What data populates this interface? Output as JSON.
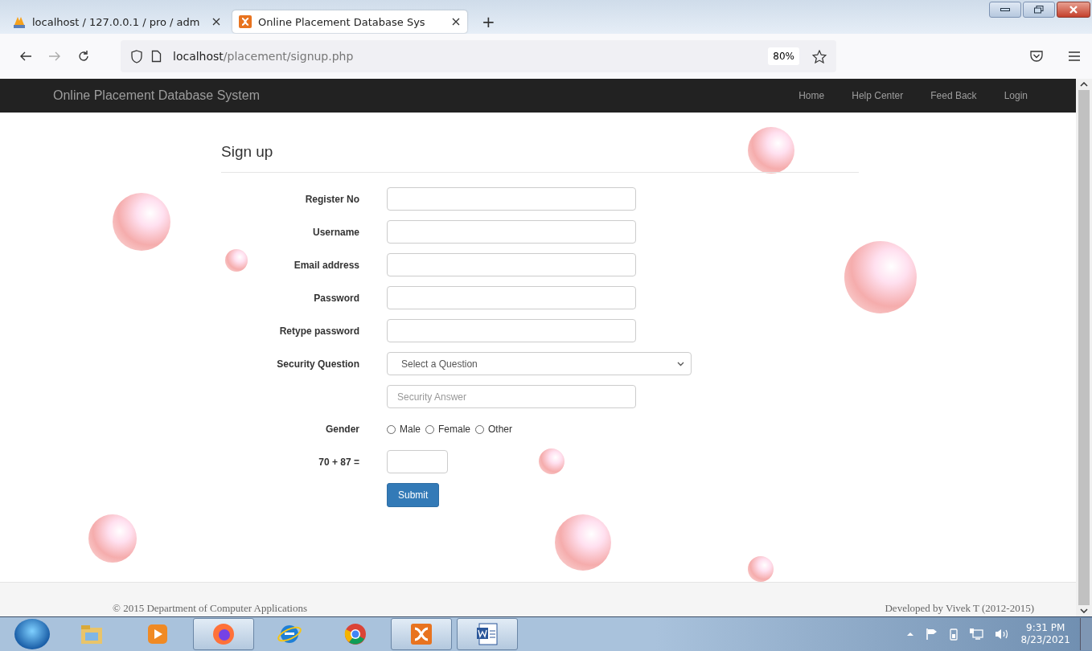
{
  "browser": {
    "tabs": [
      {
        "title": "localhost / 127.0.0.1 / pro / adm",
        "selected": false
      },
      {
        "title": "Online Placement Database Sys",
        "selected": true
      }
    ],
    "new_tab": "+",
    "url_host": "localhost",
    "url_path": "/placement/signup.php",
    "zoom": "80%"
  },
  "navbar": {
    "brand": "Online Placement Database System",
    "links": [
      "Home",
      "Help Center",
      "Feed Back",
      "Login"
    ]
  },
  "form": {
    "title": "Sign up",
    "fields": [
      {
        "kind": "text",
        "label": "Register No"
      },
      {
        "kind": "text",
        "label": "Username"
      },
      {
        "kind": "text",
        "label": "Email address"
      },
      {
        "kind": "text",
        "label": "Password"
      },
      {
        "kind": "text",
        "label": "Retype password"
      },
      {
        "kind": "select",
        "label": "Security Question",
        "value": "Select a Question"
      },
      {
        "kind": "text",
        "placeholder": "Security Answer"
      },
      {
        "kind": "radio",
        "label": "Gender",
        "options": [
          {
            "label": "Male",
            "selected": false
          },
          {
            "label": "Female",
            "selected": false
          },
          {
            "label": "Other",
            "selected": false
          }
        ]
      },
      {
        "kind": "captcha",
        "label": "70 + 87 ="
      }
    ],
    "submit": "Submit"
  },
  "footer": {
    "left": "© 2015 Department of Computer Applications",
    "right": "Developed by Vivek T (2012-2015)"
  },
  "taskbar": {
    "apps": [
      {
        "open": false
      },
      {
        "open": false
      },
      {
        "open": true
      },
      {
        "open": false
      },
      {
        "open": false
      },
      {
        "open": true
      },
      {
        "open": true
      }
    ],
    "time": "9:31 PM",
    "date": "8/23/2021"
  }
}
